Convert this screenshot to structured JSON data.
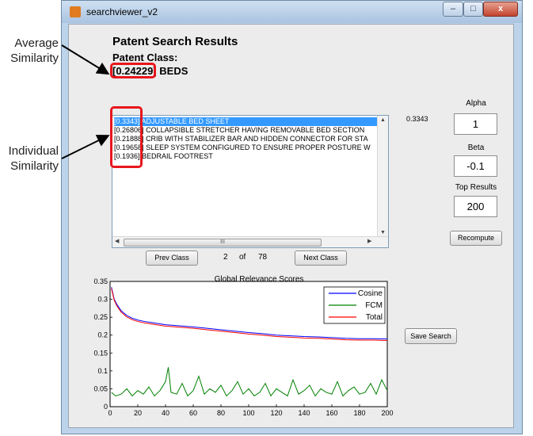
{
  "annotations": {
    "average": [
      "Average",
      "Similarity"
    ],
    "individual": [
      "Individual",
      "Similarity"
    ]
  },
  "window": {
    "title": "searchviewer_v2",
    "controls": [
      "–",
      "□",
      "x"
    ]
  },
  "header": {
    "title": "Patent Search Results",
    "class_label": "Patent Class:",
    "avg_value": "[0.24229]",
    "class_name": "BEDS"
  },
  "results": {
    "items": [
      {
        "score": "[0.3343]",
        "text": "ADJUSTABLE BED SHEET"
      },
      {
        "score": "[0.26806]",
        "text": "COLLAPSIBLE STRETCHER HAVING REMOVABLE BED SECTION"
      },
      {
        "score": "[0.21888]",
        "text": "CRIB WITH STABILIZER BAR AND HIDDEN CONNECTOR FOR STA"
      },
      {
        "score": "[0.19658]",
        "text": "SLEEP SYSTEM CONFIGURED TO ENSURE PROPER POSTURE W"
      },
      {
        "score": "[0.1936]",
        "text": "BEDRAIL FOOTREST"
      }
    ],
    "selected_value": "0.3343",
    "hscroll_grip": "III"
  },
  "nav": {
    "prev_label": "Prev Class",
    "current": "2",
    "of_label": "of",
    "total": "78",
    "next_label": "Next Class"
  },
  "params": {
    "alpha_label": "Alpha",
    "alpha_value": "1",
    "beta_label": "Beta",
    "beta_value": "-0.1",
    "top_label": "Top Results",
    "top_value": "200",
    "recompute_label": "Recompute",
    "save_label": "Save Search"
  },
  "colors": {
    "cosine": "#0000ff",
    "fcm": "#008000",
    "total": "#ff0000",
    "highlight": "#e8161c"
  },
  "chart_data": {
    "type": "line",
    "title": "Global Relevance Scores",
    "xlim": [
      0,
      200
    ],
    "ylim": [
      0,
      0.35
    ],
    "xticks": [
      0,
      20,
      40,
      60,
      80,
      100,
      120,
      140,
      160,
      180,
      200
    ],
    "yticks": [
      0,
      0.05,
      0.1,
      0.15,
      0.2,
      0.25,
      0.3,
      0.35
    ],
    "legend_position": "top-right",
    "series": [
      {
        "name": "Cosine",
        "color": "#0000ff",
        "x": [
          1,
          3,
          5,
          8,
          12,
          16,
          20,
          25,
          30,
          40,
          50,
          60,
          70,
          80,
          90,
          100,
          110,
          120,
          130,
          140,
          150,
          160,
          170,
          180,
          190,
          200
        ],
        "y": [
          0.334,
          0.3,
          0.285,
          0.268,
          0.255,
          0.247,
          0.242,
          0.238,
          0.235,
          0.229,
          0.226,
          0.223,
          0.219,
          0.215,
          0.211,
          0.207,
          0.204,
          0.2,
          0.198,
          0.196,
          0.195,
          0.193,
          0.191,
          0.19,
          0.19,
          0.189
        ]
      },
      {
        "name": "FCM",
        "color": "#008000",
        "x": [
          1,
          4,
          8,
          12,
          16,
          20,
          24,
          28,
          32,
          36,
          40,
          42,
          44,
          48,
          52,
          56,
          60,
          64,
          68,
          72,
          76,
          80,
          84,
          88,
          92,
          96,
          100,
          104,
          108,
          112,
          116,
          120,
          124,
          128,
          132,
          136,
          140,
          144,
          148,
          152,
          156,
          160,
          164,
          168,
          172,
          176,
          180,
          184,
          188,
          192,
          196,
          200
        ],
        "y": [
          0.04,
          0.03,
          0.035,
          0.05,
          0.03,
          0.045,
          0.035,
          0.055,
          0.03,
          0.045,
          0.07,
          0.11,
          0.04,
          0.035,
          0.065,
          0.03,
          0.045,
          0.085,
          0.035,
          0.05,
          0.04,
          0.06,
          0.03,
          0.045,
          0.07,
          0.035,
          0.05,
          0.03,
          0.04,
          0.065,
          0.03,
          0.05,
          0.04,
          0.03,
          0.075,
          0.035,
          0.045,
          0.06,
          0.03,
          0.05,
          0.04,
          0.035,
          0.07,
          0.03,
          0.045,
          0.055,
          0.035,
          0.04,
          0.065,
          0.035,
          0.075,
          0.045
        ]
      },
      {
        "name": "Total",
        "color": "#ff0000",
        "x": [
          1,
          3,
          5,
          8,
          12,
          16,
          20,
          25,
          30,
          40,
          50,
          60,
          70,
          80,
          90,
          100,
          110,
          120,
          130,
          140,
          150,
          160,
          170,
          180,
          190,
          200
        ],
        "y": [
          0.33,
          0.297,
          0.281,
          0.264,
          0.251,
          0.243,
          0.238,
          0.234,
          0.231,
          0.225,
          0.222,
          0.219,
          0.215,
          0.211,
          0.207,
          0.203,
          0.2,
          0.196,
          0.194,
          0.192,
          0.191,
          0.189,
          0.187,
          0.186,
          0.186,
          0.185
        ]
      }
    ]
  }
}
